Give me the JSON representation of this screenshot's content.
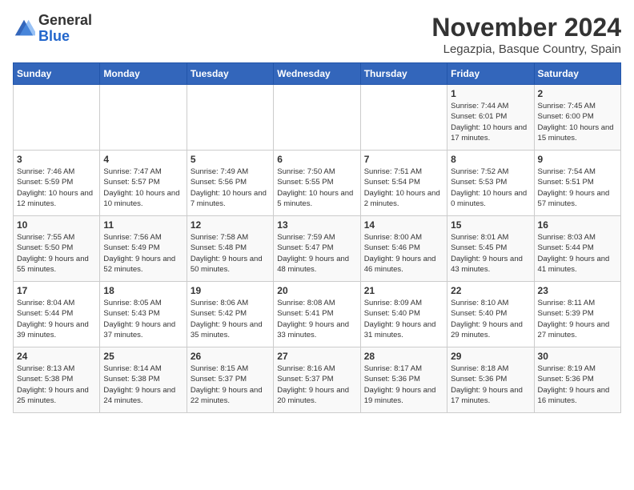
{
  "logo": {
    "general": "General",
    "blue": "Blue"
  },
  "title": "November 2024",
  "subtitle": "Legazpia, Basque Country, Spain",
  "days_of_week": [
    "Sunday",
    "Monday",
    "Tuesday",
    "Wednesday",
    "Thursday",
    "Friday",
    "Saturday"
  ],
  "weeks": [
    [
      {
        "day": "",
        "info": ""
      },
      {
        "day": "",
        "info": ""
      },
      {
        "day": "",
        "info": ""
      },
      {
        "day": "",
        "info": ""
      },
      {
        "day": "",
        "info": ""
      },
      {
        "day": "1",
        "info": "Sunrise: 7:44 AM\nSunset: 6:01 PM\nDaylight: 10 hours and 17 minutes."
      },
      {
        "day": "2",
        "info": "Sunrise: 7:45 AM\nSunset: 6:00 PM\nDaylight: 10 hours and 15 minutes."
      }
    ],
    [
      {
        "day": "3",
        "info": "Sunrise: 7:46 AM\nSunset: 5:59 PM\nDaylight: 10 hours and 12 minutes."
      },
      {
        "day": "4",
        "info": "Sunrise: 7:47 AM\nSunset: 5:57 PM\nDaylight: 10 hours and 10 minutes."
      },
      {
        "day": "5",
        "info": "Sunrise: 7:49 AM\nSunset: 5:56 PM\nDaylight: 10 hours and 7 minutes."
      },
      {
        "day": "6",
        "info": "Sunrise: 7:50 AM\nSunset: 5:55 PM\nDaylight: 10 hours and 5 minutes."
      },
      {
        "day": "7",
        "info": "Sunrise: 7:51 AM\nSunset: 5:54 PM\nDaylight: 10 hours and 2 minutes."
      },
      {
        "day": "8",
        "info": "Sunrise: 7:52 AM\nSunset: 5:53 PM\nDaylight: 10 hours and 0 minutes."
      },
      {
        "day": "9",
        "info": "Sunrise: 7:54 AM\nSunset: 5:51 PM\nDaylight: 9 hours and 57 minutes."
      }
    ],
    [
      {
        "day": "10",
        "info": "Sunrise: 7:55 AM\nSunset: 5:50 PM\nDaylight: 9 hours and 55 minutes."
      },
      {
        "day": "11",
        "info": "Sunrise: 7:56 AM\nSunset: 5:49 PM\nDaylight: 9 hours and 52 minutes."
      },
      {
        "day": "12",
        "info": "Sunrise: 7:58 AM\nSunset: 5:48 PM\nDaylight: 9 hours and 50 minutes."
      },
      {
        "day": "13",
        "info": "Sunrise: 7:59 AM\nSunset: 5:47 PM\nDaylight: 9 hours and 48 minutes."
      },
      {
        "day": "14",
        "info": "Sunrise: 8:00 AM\nSunset: 5:46 PM\nDaylight: 9 hours and 46 minutes."
      },
      {
        "day": "15",
        "info": "Sunrise: 8:01 AM\nSunset: 5:45 PM\nDaylight: 9 hours and 43 minutes."
      },
      {
        "day": "16",
        "info": "Sunrise: 8:03 AM\nSunset: 5:44 PM\nDaylight: 9 hours and 41 minutes."
      }
    ],
    [
      {
        "day": "17",
        "info": "Sunrise: 8:04 AM\nSunset: 5:44 PM\nDaylight: 9 hours and 39 minutes."
      },
      {
        "day": "18",
        "info": "Sunrise: 8:05 AM\nSunset: 5:43 PM\nDaylight: 9 hours and 37 minutes."
      },
      {
        "day": "19",
        "info": "Sunrise: 8:06 AM\nSunset: 5:42 PM\nDaylight: 9 hours and 35 minutes."
      },
      {
        "day": "20",
        "info": "Sunrise: 8:08 AM\nSunset: 5:41 PM\nDaylight: 9 hours and 33 minutes."
      },
      {
        "day": "21",
        "info": "Sunrise: 8:09 AM\nSunset: 5:40 PM\nDaylight: 9 hours and 31 minutes."
      },
      {
        "day": "22",
        "info": "Sunrise: 8:10 AM\nSunset: 5:40 PM\nDaylight: 9 hours and 29 minutes."
      },
      {
        "day": "23",
        "info": "Sunrise: 8:11 AM\nSunset: 5:39 PM\nDaylight: 9 hours and 27 minutes."
      }
    ],
    [
      {
        "day": "24",
        "info": "Sunrise: 8:13 AM\nSunset: 5:38 PM\nDaylight: 9 hours and 25 minutes."
      },
      {
        "day": "25",
        "info": "Sunrise: 8:14 AM\nSunset: 5:38 PM\nDaylight: 9 hours and 24 minutes."
      },
      {
        "day": "26",
        "info": "Sunrise: 8:15 AM\nSunset: 5:37 PM\nDaylight: 9 hours and 22 minutes."
      },
      {
        "day": "27",
        "info": "Sunrise: 8:16 AM\nSunset: 5:37 PM\nDaylight: 9 hours and 20 minutes."
      },
      {
        "day": "28",
        "info": "Sunrise: 8:17 AM\nSunset: 5:36 PM\nDaylight: 9 hours and 19 minutes."
      },
      {
        "day": "29",
        "info": "Sunrise: 8:18 AM\nSunset: 5:36 PM\nDaylight: 9 hours and 17 minutes."
      },
      {
        "day": "30",
        "info": "Sunrise: 8:19 AM\nSunset: 5:36 PM\nDaylight: 9 hours and 16 minutes."
      }
    ]
  ]
}
